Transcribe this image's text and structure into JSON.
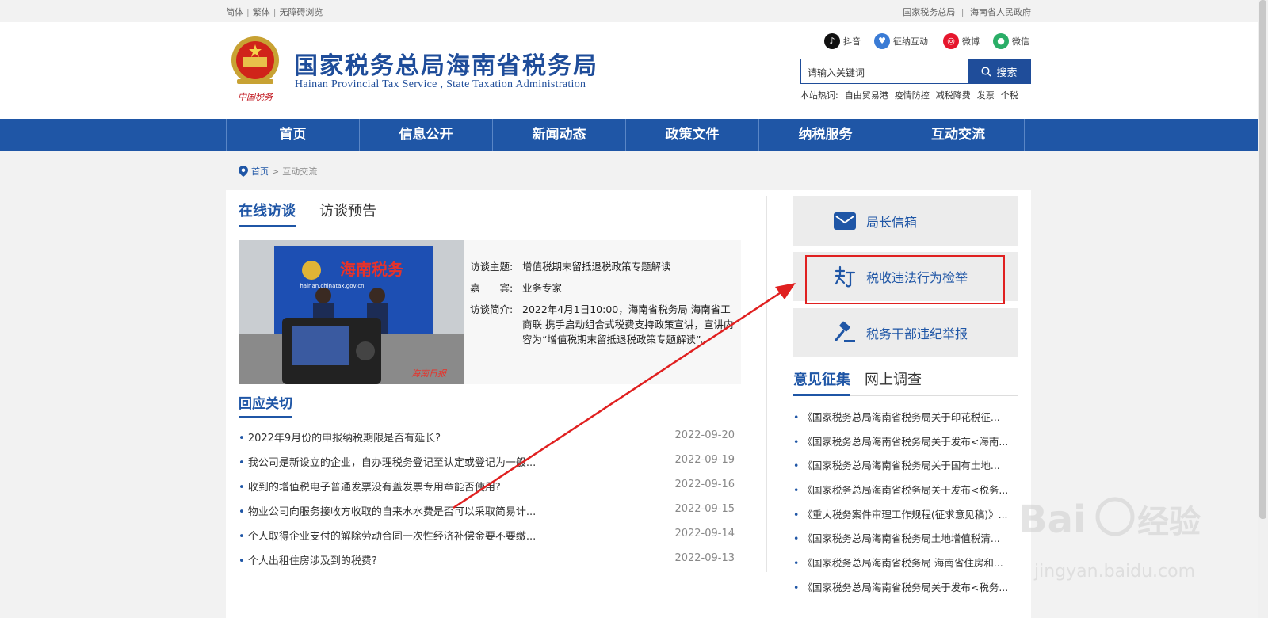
{
  "topbar": {
    "lang_simplified": "简体",
    "lang_traditional": "繁体",
    "accessibility": "无障碍浏览",
    "link_sat": "国家税务总局",
    "link_gov": "海南省人民政府"
  },
  "header": {
    "title": "国家税务总局海南省税务局",
    "subtitle": "Hainan Provincial Tax Service , State Taxation Administration",
    "emblem_caption": "中国税务",
    "social": [
      {
        "icon": "douyin-icon",
        "label": "抖音",
        "color": "#111111"
      },
      {
        "icon": "interaction-icon",
        "label": "征纳互动",
        "color": "#3a7bd5"
      },
      {
        "icon": "weibo-icon",
        "label": "微博",
        "color": "#e6162d"
      },
      {
        "icon": "wechat-icon",
        "label": "微信",
        "color": "#2aae67"
      }
    ],
    "search_placeholder": "请输入关键词",
    "search_button": "搜索",
    "hot_label": "本站热词:",
    "hot_words": [
      "自由贸易港",
      "疫情防控",
      "减税降费",
      "发票",
      "个税"
    ]
  },
  "nav": [
    "首页",
    "信息公开",
    "新闻动态",
    "政策文件",
    "纳税服务",
    "互动交流"
  ],
  "breadcrumb": {
    "home": "首页",
    "sep": ">",
    "current": "互动交流"
  },
  "interview": {
    "tabs": [
      "在线访谈",
      "访谈预告"
    ],
    "photo_banner": "海南税务",
    "photo_url_text": "hainan.chinatax.gov.cn",
    "topic_label": "访谈主题:",
    "topic": "增值税期末留抵退税政策专题解读",
    "guest_label": "嘉　　宾:",
    "guest": "业务专家",
    "intro_label": "访谈简介:",
    "intro": "2022年4月1日10:00，海南省税务局 海南省工商联 携手启动组合式税费支持政策宣讲，宣讲内容为“增值税期末留抵退税政策专题解读”。"
  },
  "responses": {
    "title": "回应关切",
    "items": [
      {
        "text": "2022年9月份的申报纳税期限是否有延长?",
        "date": "2022-09-20"
      },
      {
        "text": "我公司是新设立的企业，自办理税务登记至认定或登记为一般...",
        "date": "2022-09-19"
      },
      {
        "text": "收到的增值税电子普通发票没有盖发票专用章能否使用?",
        "date": "2022-09-16"
      },
      {
        "text": "物业公司向服务接收方收取的自来水水费是否可以采取简易计...",
        "date": "2022-09-15"
      },
      {
        "text": "个人取得企业支付的解除劳动合同一次性经济补偿金要不要缴...",
        "date": "2022-09-14"
      },
      {
        "text": "个人出租住房涉及到的税费?",
        "date": "2022-09-13"
      }
    ]
  },
  "services": [
    {
      "icon": "mail-icon",
      "label": "局长信箱"
    },
    {
      "icon": "tax-report-icon",
      "label": "税收违法行为检举"
    },
    {
      "icon": "gavel-icon",
      "label": "税务干部违纪举报"
    }
  ],
  "opinions": {
    "tabs": [
      "意见征集",
      "网上调查"
    ],
    "items": [
      "《国家税务总局海南省税务局关于印花税征...",
      "《国家税务总局海南省税务局关于发布<海南...",
      "《国家税务总局海南省税务局关于国有土地...",
      "《国家税务总局海南省税务局关于发布<税务...",
      "《重大税务案件审理工作规程(征求意见稿)》...",
      "《国家税务总局海南省税务局土地增值税清...",
      "《国家税务总局海南省税务局 海南省住房和...",
      "《国家税务总局海南省税务局关于发布<税务..."
    ]
  },
  "watermark": {
    "brand": "Bai",
    "brand2": "经验",
    "url": "jingyan.baidu.com"
  },
  "colors": {
    "primary": "#1f56a6",
    "annotation": "#e02020"
  }
}
